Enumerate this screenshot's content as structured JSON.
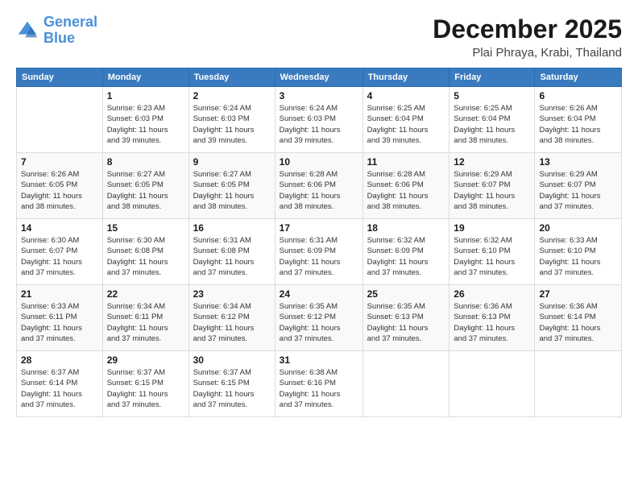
{
  "logo": {
    "line1": "General",
    "line2": "Blue"
  },
  "header": {
    "month": "December 2025",
    "location": "Plai Phraya, Krabi, Thailand"
  },
  "weekdays": [
    "Sunday",
    "Monday",
    "Tuesday",
    "Wednesday",
    "Thursday",
    "Friday",
    "Saturday"
  ],
  "weeks": [
    [
      {
        "day": "",
        "info": ""
      },
      {
        "day": "1",
        "info": "Sunrise: 6:23 AM\nSunset: 6:03 PM\nDaylight: 11 hours\nand 39 minutes."
      },
      {
        "day": "2",
        "info": "Sunrise: 6:24 AM\nSunset: 6:03 PM\nDaylight: 11 hours\nand 39 minutes."
      },
      {
        "day": "3",
        "info": "Sunrise: 6:24 AM\nSunset: 6:03 PM\nDaylight: 11 hours\nand 39 minutes."
      },
      {
        "day": "4",
        "info": "Sunrise: 6:25 AM\nSunset: 6:04 PM\nDaylight: 11 hours\nand 39 minutes."
      },
      {
        "day": "5",
        "info": "Sunrise: 6:25 AM\nSunset: 6:04 PM\nDaylight: 11 hours\nand 38 minutes."
      },
      {
        "day": "6",
        "info": "Sunrise: 6:26 AM\nSunset: 6:04 PM\nDaylight: 11 hours\nand 38 minutes."
      }
    ],
    [
      {
        "day": "7",
        "info": "Sunrise: 6:26 AM\nSunset: 6:05 PM\nDaylight: 11 hours\nand 38 minutes."
      },
      {
        "day": "8",
        "info": "Sunrise: 6:27 AM\nSunset: 6:05 PM\nDaylight: 11 hours\nand 38 minutes."
      },
      {
        "day": "9",
        "info": "Sunrise: 6:27 AM\nSunset: 6:05 PM\nDaylight: 11 hours\nand 38 minutes."
      },
      {
        "day": "10",
        "info": "Sunrise: 6:28 AM\nSunset: 6:06 PM\nDaylight: 11 hours\nand 38 minutes."
      },
      {
        "day": "11",
        "info": "Sunrise: 6:28 AM\nSunset: 6:06 PM\nDaylight: 11 hours\nand 38 minutes."
      },
      {
        "day": "12",
        "info": "Sunrise: 6:29 AM\nSunset: 6:07 PM\nDaylight: 11 hours\nand 38 minutes."
      },
      {
        "day": "13",
        "info": "Sunrise: 6:29 AM\nSunset: 6:07 PM\nDaylight: 11 hours\nand 37 minutes."
      }
    ],
    [
      {
        "day": "14",
        "info": "Sunrise: 6:30 AM\nSunset: 6:07 PM\nDaylight: 11 hours\nand 37 minutes."
      },
      {
        "day": "15",
        "info": "Sunrise: 6:30 AM\nSunset: 6:08 PM\nDaylight: 11 hours\nand 37 minutes."
      },
      {
        "day": "16",
        "info": "Sunrise: 6:31 AM\nSunset: 6:08 PM\nDaylight: 11 hours\nand 37 minutes."
      },
      {
        "day": "17",
        "info": "Sunrise: 6:31 AM\nSunset: 6:09 PM\nDaylight: 11 hours\nand 37 minutes."
      },
      {
        "day": "18",
        "info": "Sunrise: 6:32 AM\nSunset: 6:09 PM\nDaylight: 11 hours\nand 37 minutes."
      },
      {
        "day": "19",
        "info": "Sunrise: 6:32 AM\nSunset: 6:10 PM\nDaylight: 11 hours\nand 37 minutes."
      },
      {
        "day": "20",
        "info": "Sunrise: 6:33 AM\nSunset: 6:10 PM\nDaylight: 11 hours\nand 37 minutes."
      }
    ],
    [
      {
        "day": "21",
        "info": "Sunrise: 6:33 AM\nSunset: 6:11 PM\nDaylight: 11 hours\nand 37 minutes."
      },
      {
        "day": "22",
        "info": "Sunrise: 6:34 AM\nSunset: 6:11 PM\nDaylight: 11 hours\nand 37 minutes."
      },
      {
        "day": "23",
        "info": "Sunrise: 6:34 AM\nSunset: 6:12 PM\nDaylight: 11 hours\nand 37 minutes."
      },
      {
        "day": "24",
        "info": "Sunrise: 6:35 AM\nSunset: 6:12 PM\nDaylight: 11 hours\nand 37 minutes."
      },
      {
        "day": "25",
        "info": "Sunrise: 6:35 AM\nSunset: 6:13 PM\nDaylight: 11 hours\nand 37 minutes."
      },
      {
        "day": "26",
        "info": "Sunrise: 6:36 AM\nSunset: 6:13 PM\nDaylight: 11 hours\nand 37 minutes."
      },
      {
        "day": "27",
        "info": "Sunrise: 6:36 AM\nSunset: 6:14 PM\nDaylight: 11 hours\nand 37 minutes."
      }
    ],
    [
      {
        "day": "28",
        "info": "Sunrise: 6:37 AM\nSunset: 6:14 PM\nDaylight: 11 hours\nand 37 minutes."
      },
      {
        "day": "29",
        "info": "Sunrise: 6:37 AM\nSunset: 6:15 PM\nDaylight: 11 hours\nand 37 minutes."
      },
      {
        "day": "30",
        "info": "Sunrise: 6:37 AM\nSunset: 6:15 PM\nDaylight: 11 hours\nand 37 minutes."
      },
      {
        "day": "31",
        "info": "Sunrise: 6:38 AM\nSunset: 6:16 PM\nDaylight: 11 hours\nand 37 minutes."
      },
      {
        "day": "",
        "info": ""
      },
      {
        "day": "",
        "info": ""
      },
      {
        "day": "",
        "info": ""
      }
    ]
  ]
}
